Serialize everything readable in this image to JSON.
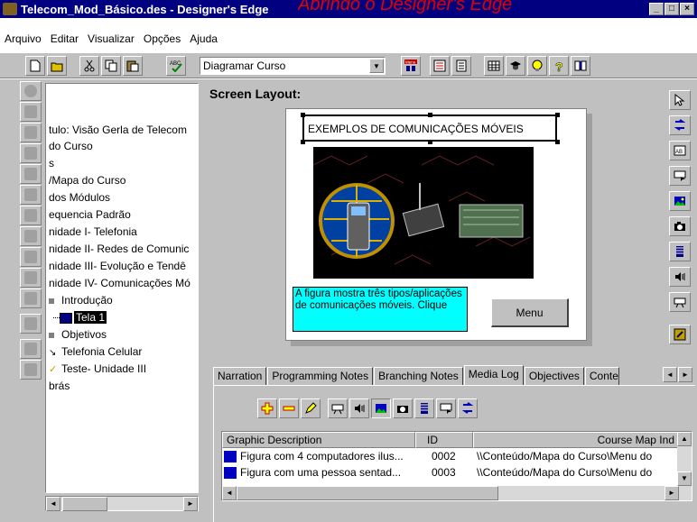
{
  "overlay_caption": "Abrindo o Designer's Edge",
  "window": {
    "title": "Telecom_Mod_Básico.des - Designer's Edge",
    "minimize": "_",
    "maximize": "□",
    "close": "×"
  },
  "menu": [
    "Arquivo",
    "Editar",
    "Visualizar",
    "Opções",
    "Ajuda"
  ],
  "toolbar": {
    "view_selected": "Diagramar Curso",
    "menu_icon_label": "Menu"
  },
  "tree": {
    "items": [
      "tulo: Visão Gerla de Telecom",
      "do Curso",
      "s",
      "/Mapa do Curso",
      "dos Módulos",
      "equencia Padrão",
      "nidade I- Telefonia",
      "nidade II- Redes de Comunic",
      "nidade III- Evolução e Tendê",
      "nidade IV- Comunicações Mó",
      "Introdução",
      "Tela 1",
      "Objetivos",
      "Telefonia Celular",
      "Teste- Unidade III",
      "brás"
    ]
  },
  "screen_layout": {
    "heading": "Screen Layout:",
    "slide_title": "EXEMPLOS DE COMUNICAÇÕES MÓVEIS",
    "slide_text": "A figura mostra três tipos/aplicações de comunicações móveis. Clique",
    "menu_button": "Menu"
  },
  "notes_tabs": [
    "Narration",
    "Programming Notes",
    "Branching Notes",
    "Media Log",
    "Objectives",
    "Conte"
  ],
  "active_tab": "Media Log",
  "media_log": {
    "columns": [
      "Graphic Description",
      "ID",
      "Course Map Ind"
    ],
    "rows": [
      {
        "description": "Figura com 4 computadores ilus...",
        "id": "0002",
        "path": "\\\\Conteúdo/Mapa do Curso\\Menu do"
      },
      {
        "description": "Figura com uma pessoa sentad...",
        "id": "0003",
        "path": "\\\\Conteúdo/Mapa do Curso\\Menu do"
      }
    ]
  },
  "colors": {
    "titlebar": "#000080",
    "caption": "#e00000",
    "slide_text_bg": "#00ffff",
    "face": "#c0c0c0"
  }
}
